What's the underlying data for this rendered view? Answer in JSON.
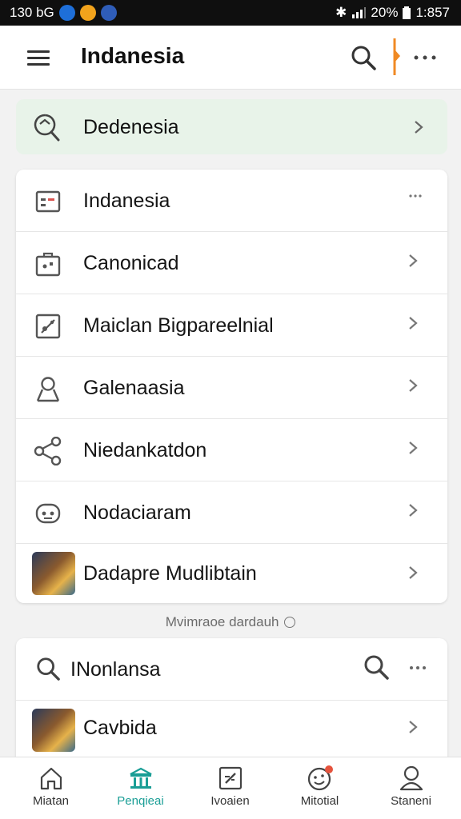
{
  "status_bar": {
    "left_text": "130 bG",
    "battery": "20%",
    "time": "1:857"
  },
  "top_bar": {
    "title": "Indanesia"
  },
  "highlight": {
    "label": "Dedenesia"
  },
  "list_card": {
    "items": [
      {
        "label": "Indanesia",
        "icon": "card-icon",
        "trailing": "more"
      },
      {
        "label": "Canonicad",
        "icon": "briefcase-icon",
        "trailing": "chevron"
      },
      {
        "label": "Maiclan Bigpareelnial",
        "icon": "chart-icon",
        "trailing": "chevron"
      },
      {
        "label": "Galenaasia",
        "icon": "person-icon",
        "trailing": "chevron"
      },
      {
        "label": "Niedankatdon",
        "icon": "share-icon",
        "trailing": "chevron"
      },
      {
        "label": "Nodaciaram",
        "icon": "robot-icon",
        "trailing": "chevron"
      },
      {
        "label": "Dadapre Mudlibtain",
        "icon": "game-thumbnail",
        "trailing": "chevron"
      }
    ]
  },
  "caption": {
    "text": "Mvimraoe dardauh"
  },
  "second_card": {
    "search_label": "INonlansa",
    "item_label": "Cavbida"
  },
  "bottom_nav": {
    "items": [
      {
        "label": "Miatan",
        "icon": "home-icon",
        "active": false
      },
      {
        "label": "Penqieai",
        "icon": "bank-icon",
        "active": true
      },
      {
        "label": "Ivoaien",
        "icon": "edit-icon",
        "active": false
      },
      {
        "label": "Mitotial",
        "icon": "emoji-icon",
        "active": false
      },
      {
        "label": "Staneni",
        "icon": "profile-icon",
        "active": false
      }
    ]
  },
  "colors": {
    "accent": "#1a9e96",
    "highlight_bg": "#e8f3e9",
    "orange": "#f08a24"
  }
}
